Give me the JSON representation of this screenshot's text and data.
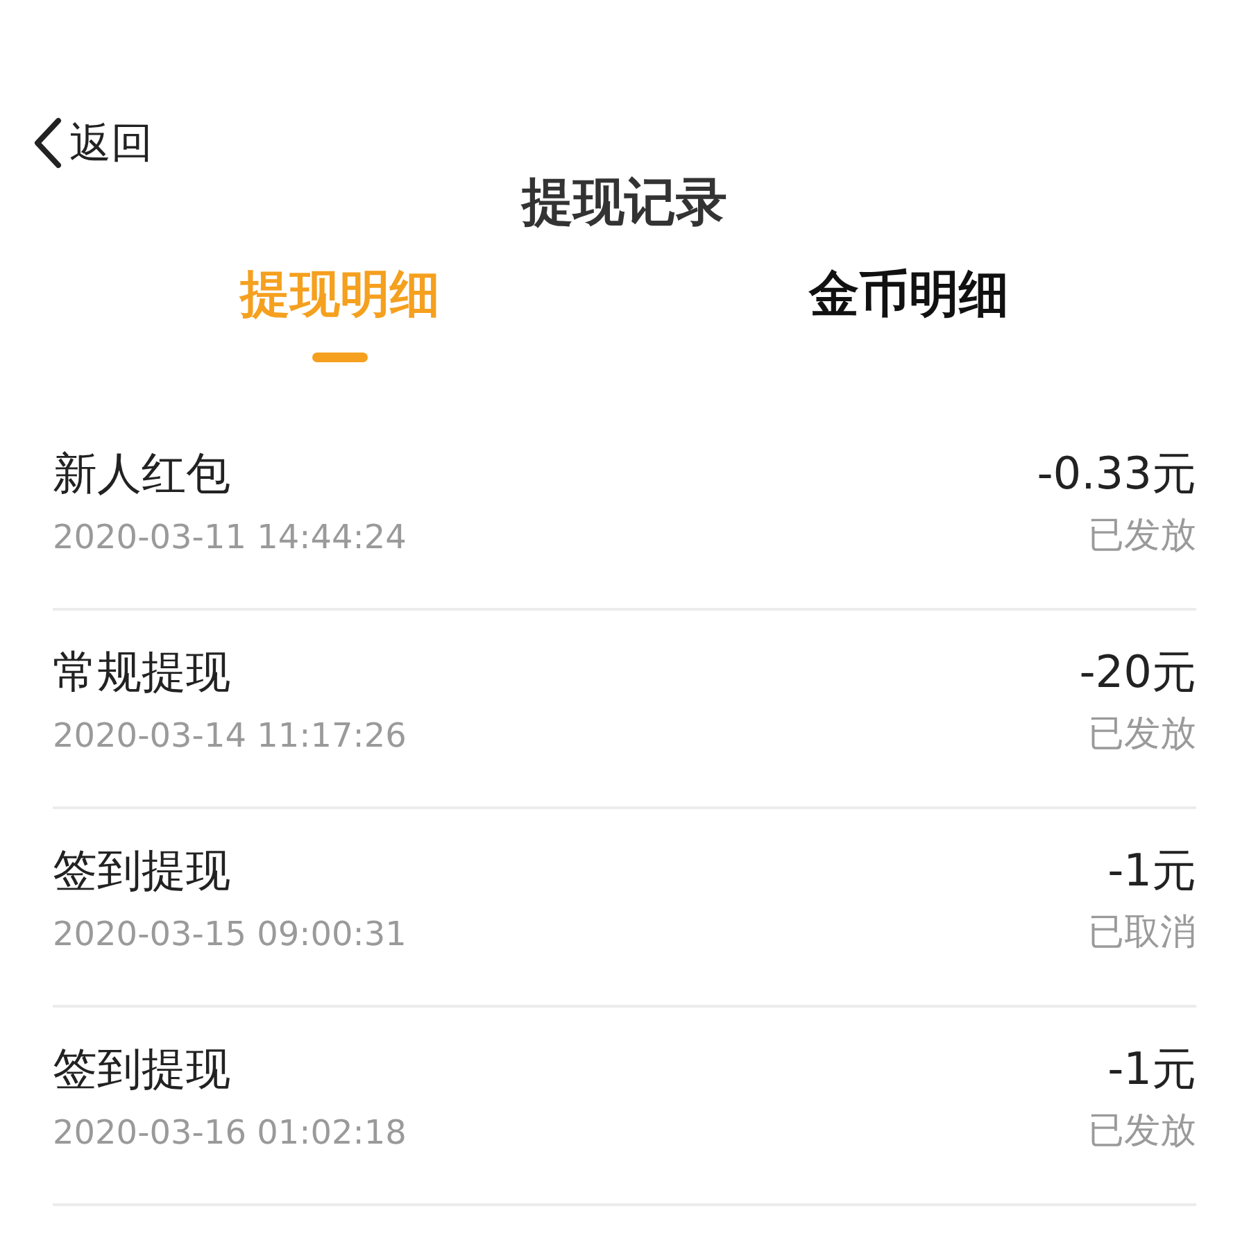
{
  "back": {
    "label": "返回"
  },
  "title": "提现记录",
  "tabs": [
    {
      "label": "提现明细",
      "selected": true
    },
    {
      "label": "金币明细",
      "selected": false
    }
  ],
  "records": [
    {
      "name": "新人红包",
      "time": "2020-03-11 14:44:24",
      "amount": "-0.33元",
      "status": "已发放"
    },
    {
      "name": "常规提现",
      "time": "2020-03-14 11:17:26",
      "amount": "-20元",
      "status": "已发放"
    },
    {
      "name": "签到提现",
      "time": "2020-03-15 09:00:31",
      "amount": "-1元",
      "status": "已取消"
    },
    {
      "name": "签到提现",
      "time": "2020-03-16 01:02:18",
      "amount": "-1元",
      "status": "已发放"
    }
  ]
}
